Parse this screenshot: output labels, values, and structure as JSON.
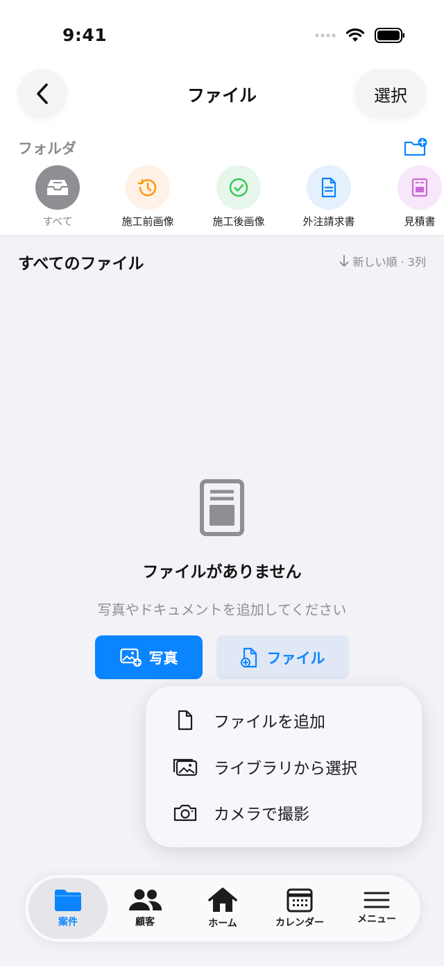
{
  "status_bar": {
    "time": "9:41"
  },
  "header": {
    "title": "ファイル",
    "select_label": "選択"
  },
  "folders": {
    "section_label": "フォルダ",
    "items": [
      {
        "label": "すべて",
        "icon": "tray-icon",
        "color": "#8e8e93",
        "active": true
      },
      {
        "label": "施工前画像",
        "icon": "clock-history-icon",
        "color": "#ff9500"
      },
      {
        "label": "施工後画像",
        "icon": "checkmark-circle-icon",
        "color": "#34c759"
      },
      {
        "label": "外注請求書",
        "icon": "document-icon",
        "color": "#0a84ff"
      },
      {
        "label": "見積書",
        "icon": "quote-document-icon",
        "color": "#c86bd6"
      }
    ]
  },
  "files": {
    "section_title": "すべてのファイル",
    "sort_label": "新しい順 · 3列"
  },
  "empty_state": {
    "title": "ファイルがありません",
    "subtitle": "写真やドキュメントを追加してください",
    "photo_button": "写真",
    "file_button": "ファイル"
  },
  "add_menu": {
    "items": [
      {
        "label": "ファイルを追加",
        "icon": "doc-icon"
      },
      {
        "label": "ライブラリから選択",
        "icon": "photo-library-icon"
      },
      {
        "label": "カメラで撮影",
        "icon": "camera-icon"
      }
    ]
  },
  "tabbar": {
    "items": [
      {
        "label": "案件",
        "icon": "folder-icon",
        "active": true
      },
      {
        "label": "顧客",
        "icon": "people-icon"
      },
      {
        "label": "ホーム",
        "icon": "house-icon"
      },
      {
        "label": "カレンダー",
        "icon": "calendar-icon"
      },
      {
        "label": "メニュー",
        "icon": "menu-icon"
      }
    ]
  },
  "colors": {
    "accent": "#0a84ff",
    "background": "#f2f2f7"
  }
}
